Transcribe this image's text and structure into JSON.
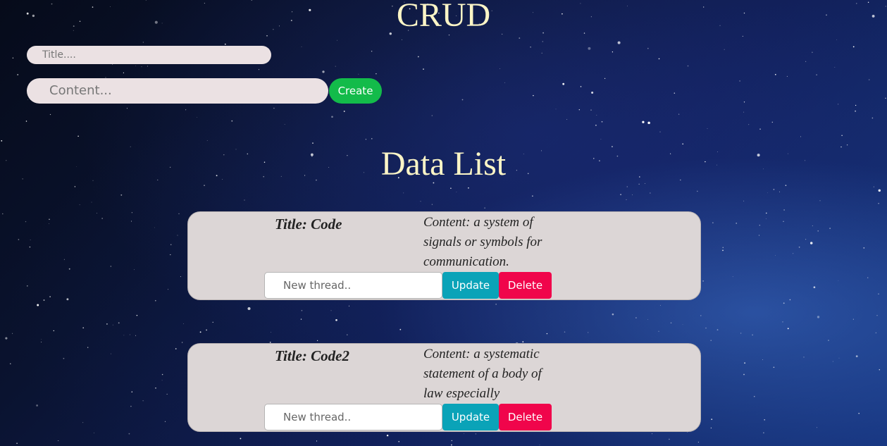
{
  "header": {
    "title": "CRUD"
  },
  "form": {
    "title_placeholder": "Title....",
    "content_placeholder": "Content...",
    "create_label": "Create"
  },
  "list": {
    "heading": "Data List",
    "items": [
      {
        "title": "Title: Code",
        "content": "Content: a system of signals or symbols for communication.",
        "thread_placeholder": "New thread..",
        "update_label": "Update",
        "delete_label": "Delete"
      },
      {
        "title": "Title: Code2",
        "content": "Content: a systematic statement of a body of law especially",
        "thread_placeholder": "New thread..",
        "update_label": "Update",
        "delete_label": "Delete"
      }
    ]
  },
  "colors": {
    "heading": "#fbf5c6",
    "create_button": "#13bb4a",
    "update_button": "#0aa3b8",
    "delete_button": "#f0054b",
    "card_background": "#dcd6d6"
  }
}
